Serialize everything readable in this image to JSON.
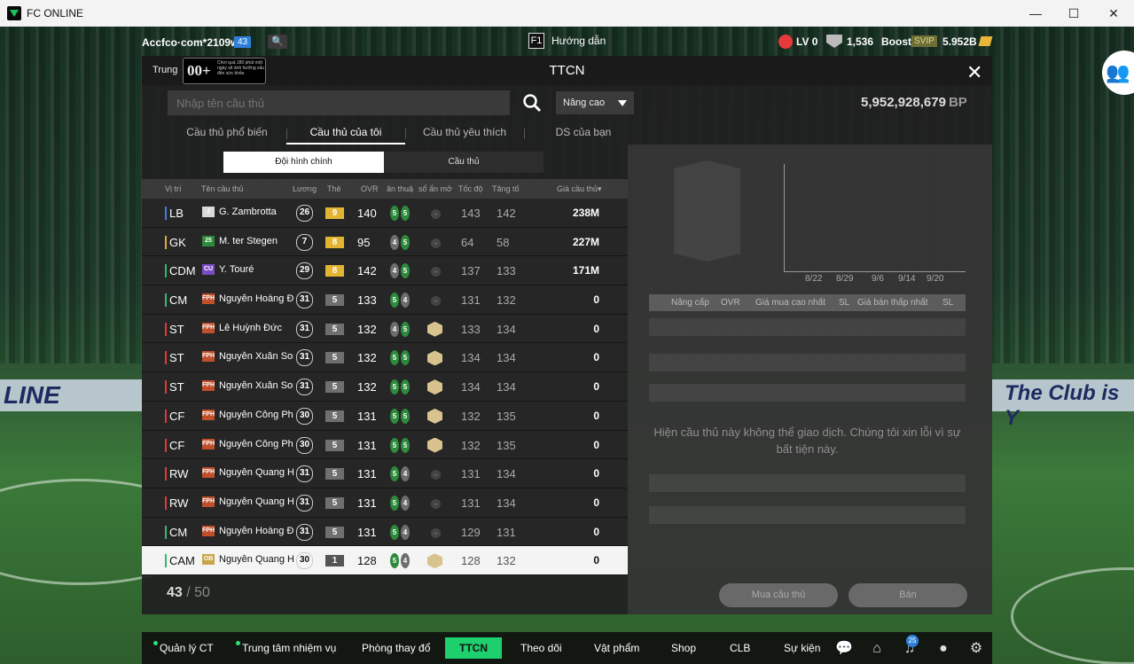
{
  "window": {
    "title": "FC ONLINE",
    "minimize": "—",
    "maximize": "☐",
    "close": "✕"
  },
  "hud": {
    "account": "Accfco·com*2109w",
    "level_badge": "43",
    "f1_key": "F1",
    "guide": "Hướng dẫn",
    "lv": "LV 0",
    "shield_value": "1,536",
    "boost": "Boost",
    "svip": "SVIP",
    "currency": "5.952B"
  },
  "background": {
    "board_text_left": "LINE",
    "board_text_right": "The Club is Y"
  },
  "panel": {
    "title": "TTCN",
    "back_label": "Trung",
    "tooltip_big": "00+",
    "tooltip_small": "Chơi quá 180 phút một ngày sẽ ảnh hưởng xấu đến sức khỏe.",
    "close": "✕"
  },
  "search": {
    "placeholder": "Nhập tên cầu thủ",
    "advanced": "Nâng cao"
  },
  "bp": {
    "value": "5,952,928,679",
    "unit": "BP"
  },
  "tabs": [
    "Cầu thủ phổ biến",
    "Cầu thủ của tôi",
    "Cầu thủ yêu thích",
    "DS của bạn"
  ],
  "active_tab": 1,
  "subtabs": [
    "Đội hình chính",
    "Cầu thủ"
  ],
  "columns": [
    "Vị trí",
    "Tên cầu thủ",
    "Lương",
    "Thẻ",
    "OVR",
    "ân thuậ",
    "sổ ẩn mở",
    "Tốc độ",
    "Tăng tố",
    "Giá cầu thủ▾"
  ],
  "players": [
    {
      "pos": "LB",
      "pos_color": "#3f7fe8",
      "season": "J",
      "season_color": "#d9d9d9",
      "name": "G. Zambrotta",
      "salary": "26",
      "grade": "9",
      "grade_color": "#e2b431",
      "ovr": "140",
      "foot_l": "5",
      "foot_r": "5",
      "trait": false,
      "speed": "143",
      "accel": "142",
      "price": "238M"
    },
    {
      "pos": "GK",
      "pos_color": "#e6a53a",
      "season": "25",
      "season_color": "#2d8a3c",
      "name": "M. ter Stegen",
      "salary": "7",
      "grade": "8",
      "grade_color": "#e2b431",
      "ovr": "95",
      "foot_l": "4",
      "foot_r": "5",
      "trait": false,
      "speed": "64",
      "accel": "58",
      "price": "227M"
    },
    {
      "pos": "CDM",
      "pos_color": "#2bbd6a",
      "season": "CU",
      "season_color": "#7b4bc2",
      "name": "Y. Touré",
      "salary": "29",
      "grade": "8",
      "grade_color": "#e2b431",
      "ovr": "142",
      "foot_l": "4",
      "foot_r": "5",
      "trait": false,
      "speed": "137",
      "accel": "133",
      "price": "171M"
    },
    {
      "pos": "CM",
      "pos_color": "#2bbd6a",
      "season": "FPH",
      "season_color": "#c0502c",
      "name": "Nguyễn Hoàng Đức",
      "salary": "31",
      "grade": "5",
      "grade_color": "#6f6f6f",
      "ovr": "133",
      "foot_l": "5",
      "foot_r": "4",
      "trait": false,
      "speed": "131",
      "accel": "132",
      "price": "0"
    },
    {
      "pos": "ST",
      "pos_color": "#e03a3a",
      "season": "FPH",
      "season_color": "#c0502c",
      "name": "Lê Huỳnh Đức",
      "salary": "31",
      "grade": "5",
      "grade_color": "#6f6f6f",
      "ovr": "132",
      "foot_l": "4",
      "foot_r": "5",
      "trait": true,
      "speed": "133",
      "accel": "134",
      "price": "0"
    },
    {
      "pos": "ST",
      "pos_color": "#e03a3a",
      "season": "FPH",
      "season_color": "#c0502c",
      "name": "Nguyễn Xuân Son",
      "salary": "31",
      "grade": "5",
      "grade_color": "#6f6f6f",
      "ovr": "132",
      "foot_l": "5",
      "foot_r": "5",
      "trait": true,
      "speed": "134",
      "accel": "134",
      "price": "0"
    },
    {
      "pos": "ST",
      "pos_color": "#e03a3a",
      "season": "FPH",
      "season_color": "#c0502c",
      "name": "Nguyễn Xuân Son",
      "salary": "31",
      "grade": "5",
      "grade_color": "#6f6f6f",
      "ovr": "132",
      "foot_l": "5",
      "foot_r": "5",
      "trait": true,
      "speed": "134",
      "accel": "134",
      "price": "0"
    },
    {
      "pos": "CF",
      "pos_color": "#e03a3a",
      "season": "FPH",
      "season_color": "#c0502c",
      "name": "Nguyễn Công Phượng",
      "salary": "30",
      "grade": "5",
      "grade_color": "#6f6f6f",
      "ovr": "131",
      "foot_l": "5",
      "foot_r": "5",
      "trait": true,
      "speed": "132",
      "accel": "135",
      "price": "0"
    },
    {
      "pos": "CF",
      "pos_color": "#e03a3a",
      "season": "FPH",
      "season_color": "#c0502c",
      "name": "Nguyễn Công Phượng",
      "salary": "30",
      "grade": "5",
      "grade_color": "#6f6f6f",
      "ovr": "131",
      "foot_l": "5",
      "foot_r": "5",
      "trait": true,
      "speed": "132",
      "accel": "135",
      "price": "0"
    },
    {
      "pos": "RW",
      "pos_color": "#e03a3a",
      "season": "FPH",
      "season_color": "#c0502c",
      "name": "Nguyễn Quang Hải",
      "salary": "31",
      "grade": "5",
      "grade_color": "#6f6f6f",
      "ovr": "131",
      "foot_l": "5",
      "foot_r": "4",
      "trait": false,
      "speed": "131",
      "accel": "134",
      "price": "0"
    },
    {
      "pos": "RW",
      "pos_color": "#e03a3a",
      "season": "FPH",
      "season_color": "#c0502c",
      "name": "Nguyễn Quang Hải",
      "salary": "31",
      "grade": "5",
      "grade_color": "#6f6f6f",
      "ovr": "131",
      "foot_l": "5",
      "foot_r": "4",
      "trait": false,
      "speed": "131",
      "accel": "134",
      "price": "0"
    },
    {
      "pos": "CM",
      "pos_color": "#2bbd6a",
      "season": "FPH",
      "season_color": "#c0502c",
      "name": "Nguyễn Hoàng Đức",
      "salary": "31",
      "grade": "5",
      "grade_color": "#6f6f6f",
      "ovr": "131",
      "foot_l": "5",
      "foot_r": "4",
      "trait": false,
      "speed": "129",
      "accel": "131",
      "price": "0"
    },
    {
      "pos": "CAM",
      "pos_color": "#2bbd6a",
      "season": "OB",
      "season_color": "#c9a34a",
      "name": "Nguyễn Quang Hải",
      "salary": "30",
      "grade": "1",
      "grade_color": "#555555",
      "ovr": "128",
      "foot_l": "5",
      "foot_r": "4",
      "trait": true,
      "speed": "128",
      "accel": "132",
      "price": "0",
      "selected": true
    }
  ],
  "count": {
    "current": "43",
    "max": "50",
    "sep": "/"
  },
  "right": {
    "dates": [
      "8/22",
      "8/29",
      "9/6",
      "9/14",
      "9/20"
    ],
    "columns": [
      "Nâng cấp",
      "OVR",
      "Giá mua cao nhất",
      "SL",
      "Giá bán thấp nhất",
      "SL"
    ],
    "message": "Hiện cầu thủ này không thể giao dịch. Chúng tôi xin lỗi vì sự bất tiện này.",
    "buy": "Mua cầu thủ",
    "sell": "Bán"
  },
  "bottom": {
    "items": [
      "Quản lý CT",
      "Trung tâm nhiệm vụ",
      "Phòng thay đổ",
      "TTCN",
      "Theo dõi",
      "Vật phẩm",
      "Shop",
      "CLB",
      "Sự kiện"
    ],
    "notif_count": "25"
  }
}
